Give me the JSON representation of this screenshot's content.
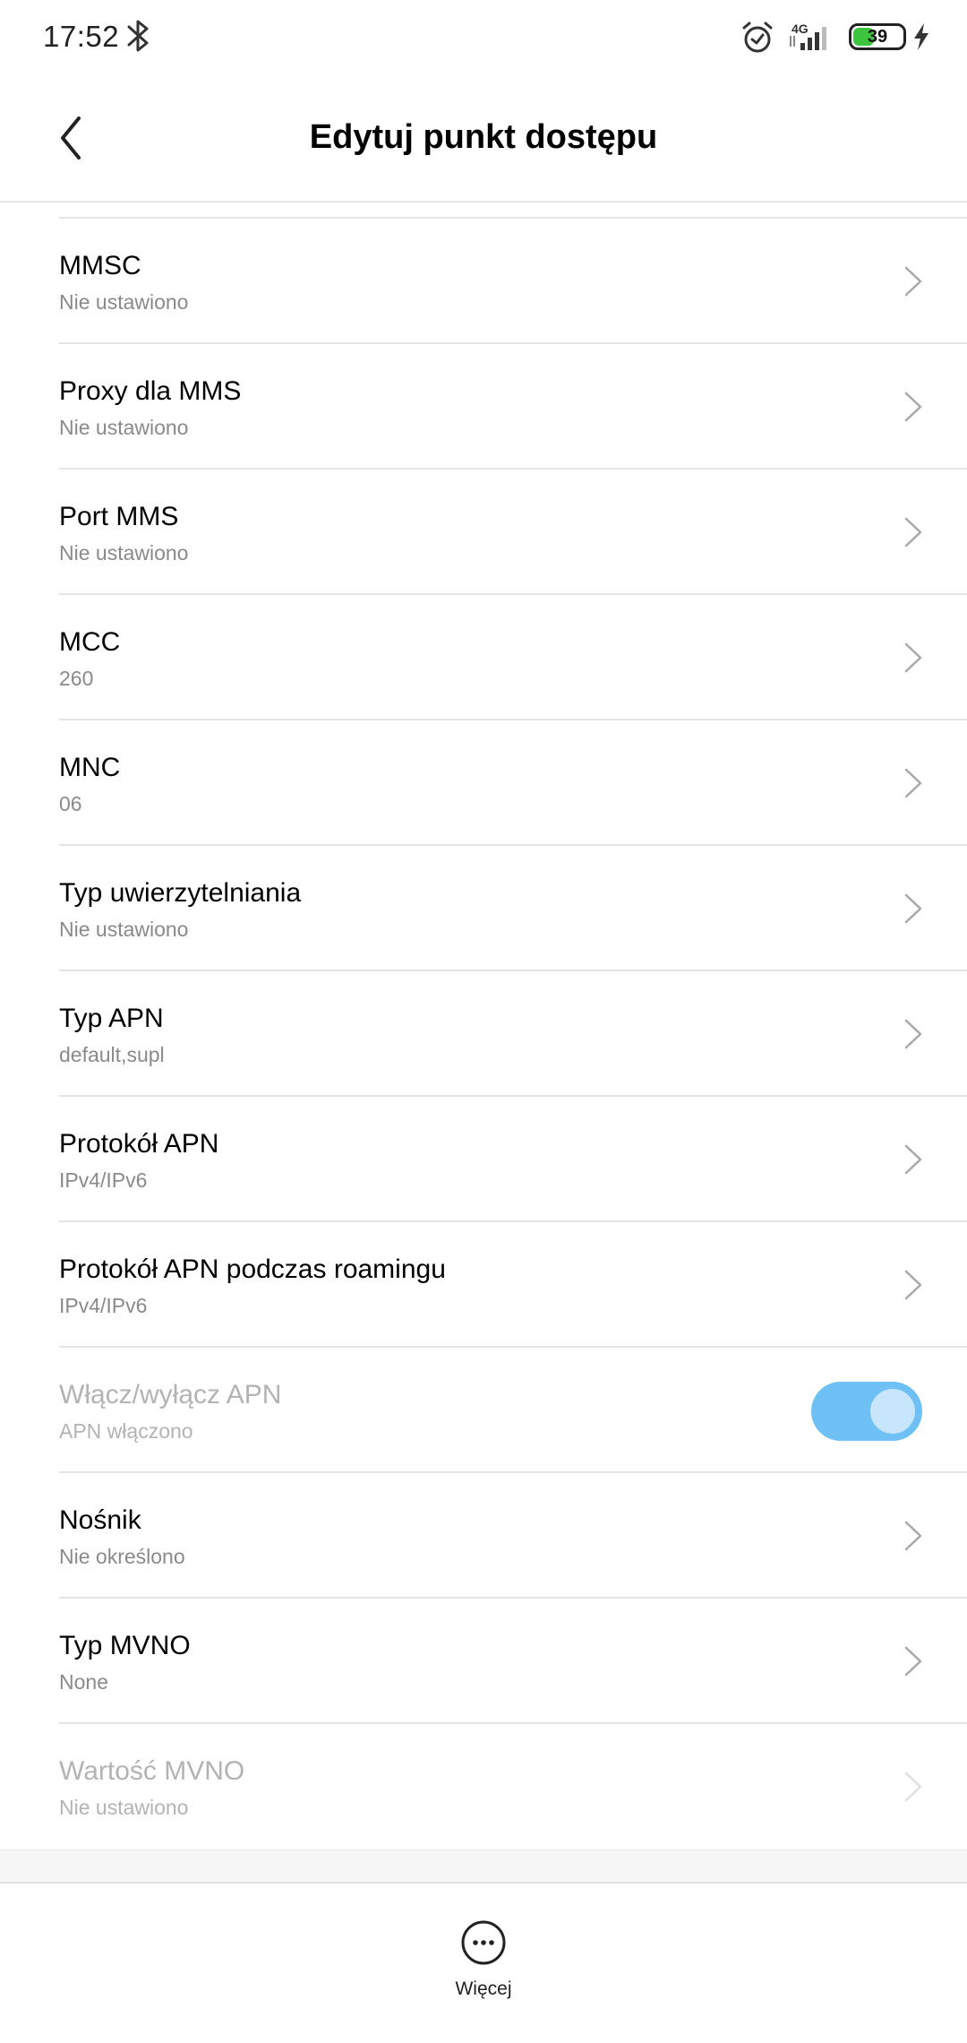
{
  "status_bar": {
    "time": "17:52",
    "network": "4G",
    "battery": "39",
    "battery_level": 0.39,
    "icons": [
      "bluetooth-icon",
      "alarm-icon",
      "signal-icon",
      "battery-icon",
      "charging-icon"
    ]
  },
  "header": {
    "title": "Edytuj punkt dostępu",
    "back_icon": "chevron-left-icon"
  },
  "rows": [
    {
      "title": "MMSC",
      "value": "Nie ustawiono"
    },
    {
      "title": "Proxy dla MMS",
      "value": "Nie ustawiono"
    },
    {
      "title": "Port MMS",
      "value": "Nie ustawiono"
    },
    {
      "title": "MCC",
      "value": "260"
    },
    {
      "title": "MNC",
      "value": "06"
    },
    {
      "title": "Typ uwierzytelniania",
      "value": "Nie ustawiono"
    },
    {
      "title": "Typ APN",
      "value": "default,supl"
    },
    {
      "title": "Protokół APN",
      "value": "IPv4/IPv6"
    },
    {
      "title": "Protokół APN podczas roamingu",
      "value": "IPv4/IPv6"
    },
    {
      "title": "Włącz/wyłącz APN",
      "value": "APN włączono",
      "toggle": true,
      "toggle_on": true,
      "disabled": true
    },
    {
      "title": "Nośnik",
      "value": "Nie określono"
    },
    {
      "title": "Typ MVNO",
      "value": "None"
    },
    {
      "title": "Wartość MVNO",
      "value": "Nie ustawiono",
      "disabled": true
    }
  ],
  "bottom_bar": {
    "more_label": "Więcej",
    "more_icon": "more-horizontal-icon"
  },
  "colors": {
    "toggle_track": "#6fc0f5",
    "toggle_knob": "#c7e6fb",
    "battery_fill": "#3fc43f",
    "secondary_text": "#8a8a8a",
    "disabled_text": "#b3b3b3"
  }
}
